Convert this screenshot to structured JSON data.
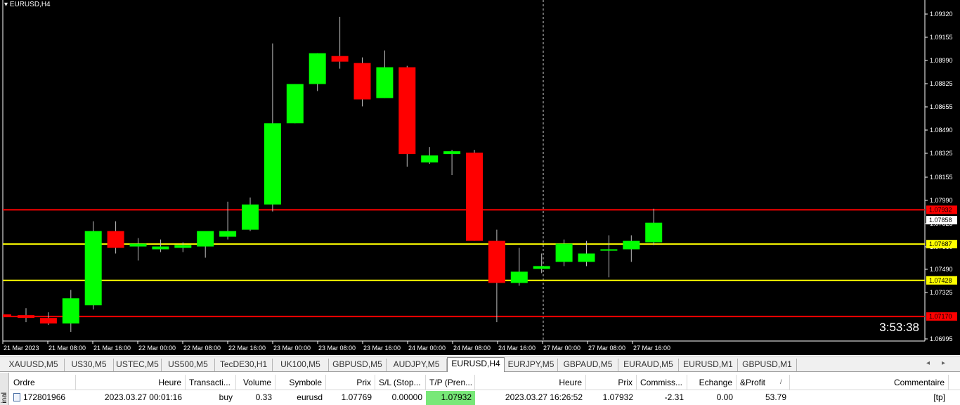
{
  "chart": {
    "title": "EURUSD,H4",
    "timer": "3:53:38",
    "colors": {
      "up": "#00ff00",
      "down": "#ff0000",
      "wick": "#c0c0c0",
      "bg": "#000000",
      "axis": "#ffffff"
    },
    "y_ticks": [
      "1.09320",
      "1.09155",
      "1.08990",
      "1.08825",
      "1.08655",
      "1.08490",
      "1.08325",
      "1.08155",
      "1.07990",
      "1.07825",
      "1.07660",
      "1.07490",
      "1.07325",
      "1.06995"
    ],
    "x_ticks": [
      "21 Mar 2023",
      "21 Mar 08:00",
      "21 Mar 16:00",
      "22 Mar 00:00",
      "22 Mar 08:00",
      "22 Mar 16:00",
      "23 Mar 00:00",
      "23 Mar 08:00",
      "23 Mar 16:00",
      "24 Mar 00:00",
      "24 Mar 08:00",
      "24 Mar 16:00",
      "27 Mar 00:00",
      "27 Mar 08:00",
      "27 Mar 16:00"
    ],
    "price_labels": [
      {
        "value": "1.07932",
        "price": 1.07932,
        "color": "#ff0000",
        "text_color": "#000000"
      },
      {
        "value": "1.07858",
        "price": 1.07858,
        "color": "#ffffff",
        "text_color": "#000000"
      },
      {
        "value": "1.07687",
        "price": 1.07687,
        "color": "#ffff00",
        "text_color": "#000000"
      },
      {
        "value": "1.07428",
        "price": 1.07428,
        "color": "#ffff00",
        "text_color": "#000000"
      },
      {
        "value": "1.07170",
        "price": 1.0717,
        "color": "#ff0000",
        "text_color": "#000000"
      }
    ],
    "hlines": [
      {
        "price": 1.07932,
        "color": "#ff0000"
      },
      {
        "price": 1.07687,
        "color": "#ffff00"
      },
      {
        "price": 1.07428,
        "color": "#ffff00"
      },
      {
        "price": 1.0717,
        "color": "#ff0000"
      }
    ]
  },
  "chart_data": {
    "type": "candlestick",
    "symbol": "EURUSD",
    "timeframe": "H4",
    "ylim": [
      1.06995,
      1.094
    ],
    "candles": [
      {
        "o": 1.0718,
        "h": 1.0723,
        "l": 1.0713,
        "c": 1.0716
      },
      {
        "o": 1.0716,
        "h": 1.072,
        "l": 1.0711,
        "c": 1.0712
      },
      {
        "o": 1.0712,
        "h": 1.0736,
        "l": 1.0706,
        "c": 1.073
      },
      {
        "o": 1.0725,
        "h": 1.0785,
        "l": 1.0722,
        "c": 1.0778
      },
      {
        "o": 1.0778,
        "h": 1.0785,
        "l": 1.0762,
        "c": 1.0766
      },
      {
        "o": 1.0767,
        "h": 1.0773,
        "l": 1.0757,
        "c": 1.0769
      },
      {
        "o": 1.0765,
        "h": 1.0772,
        "l": 1.0763,
        "c": 1.0767
      },
      {
        "o": 1.0766,
        "h": 1.077,
        "l": 1.0763,
        "c": 1.0768
      },
      {
        "o": 1.0767,
        "h": 1.0777,
        "l": 1.0759,
        "c": 1.0778
      },
      {
        "o": 1.0774,
        "h": 1.0799,
        "l": 1.0772,
        "c": 1.0778
      },
      {
        "o": 1.0779,
        "h": 1.0802,
        "l": 1.0778,
        "c": 1.0797
      },
      {
        "o": 1.0797,
        "h": 1.0912,
        "l": 1.0792,
        "c": 1.0855
      },
      {
        "o": 1.0855,
        "h": 1.0883,
        "l": 1.0855,
        "c": 1.0883
      },
      {
        "o": 1.0883,
        "h": 1.0905,
        "l": 1.0878,
        "c": 1.0905
      },
      {
        "o": 1.0903,
        "h": 1.0931,
        "l": 1.0894,
        "c": 1.0899
      },
      {
        "o": 1.0898,
        "h": 1.0902,
        "l": 1.0867,
        "c": 1.0872
      },
      {
        "o": 1.0873,
        "h": 1.0907,
        "l": 1.0873,
        "c": 1.0895
      },
      {
        "o": 1.0895,
        "h": 1.0896,
        "l": 1.0824,
        "c": 1.0833
      },
      {
        "o": 1.0827,
        "h": 1.0838,
        "l": 1.0826,
        "c": 1.0832
      },
      {
        "o": 1.0833,
        "h": 1.0836,
        "l": 1.0818,
        "c": 1.0835
      },
      {
        "o": 1.0834,
        "h": 1.0836,
        "l": 1.0771,
        "c": 1.0771
      },
      {
        "o": 1.0771,
        "h": 1.0779,
        "l": 1.0713,
        "c": 1.0741
      },
      {
        "o": 1.0741,
        "h": 1.0766,
        "l": 1.0739,
        "c": 1.0749
      },
      {
        "o": 1.0751,
        "h": 1.0762,
        "l": 1.0748,
        "c": 1.0753
      },
      {
        "o": 1.0756,
        "h": 1.0772,
        "l": 1.0753,
        "c": 1.0769
      },
      {
        "o": 1.0756,
        "h": 1.0771,
        "l": 1.0753,
        "c": 1.0762
      },
      {
        "o": 1.0764,
        "h": 1.0775,
        "l": 1.0745,
        "c": 1.0765
      },
      {
        "o": 1.0765,
        "h": 1.0775,
        "l": 1.0756,
        "c": 1.0771
      },
      {
        "o": 1.077,
        "h": 1.0794,
        "l": 1.0768,
        "c": 1.0784
      }
    ]
  },
  "tabs": {
    "items": [
      "XAUUSD,M5",
      "US30,M5",
      "USTEC,M5",
      "US500,M5",
      "TecDE30,H1",
      "UK100,M5",
      "GBPUSD,M5",
      "AUDJPY,M5",
      "EURUSD,H4",
      "EURJPY,M5",
      "GBPAUD,M5",
      "EURAUD,M5",
      "EURUSD,M1",
      "GBPUSD,M1"
    ],
    "active_index": 8,
    "left_arrow": "◂",
    "right_arrow": "▸"
  },
  "terminal": {
    "side_label": "inal",
    "headers": [
      "Ordre",
      "Heure",
      "Transacti...",
      "Volume",
      "Symbole",
      "Prix",
      "S/L (Stop...",
      "T/P (Pren...",
      "Heure",
      "Prix",
      "Commiss...",
      "Echange",
      "&Profit",
      "Commentaire"
    ],
    "sort_marker": "/",
    "row": [
      "172801966",
      "2023.03.27 00:01:16",
      "buy",
      "0.33",
      "eurusd",
      "1.07769",
      "0.00000",
      "1.07932",
      "2023.03.27 16:26:52",
      "1.07932",
      "-2.31",
      "0.00",
      "53.79",
      "[tp]"
    ]
  }
}
